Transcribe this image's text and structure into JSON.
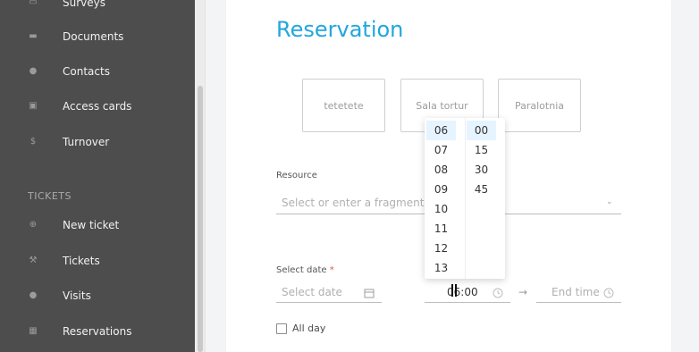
{
  "sidebar": {
    "items_top": [
      {
        "label": "Surveys",
        "icon": "clipboard-icon"
      },
      {
        "label": "Documents",
        "icon": "folder-icon"
      },
      {
        "label": "Contacts",
        "icon": "contacts-icon"
      },
      {
        "label": "Access cards",
        "icon": "card-icon"
      },
      {
        "label": "Turnover",
        "icon": "dollar-icon"
      }
    ],
    "section_title": "TICKETS",
    "items_tickets": [
      {
        "label": "New ticket",
        "icon": "plus-circle-icon"
      },
      {
        "label": "Tickets",
        "icon": "wrench-icon"
      },
      {
        "label": "Visits",
        "icon": "person-icon"
      },
      {
        "label": "Reservations",
        "icon": "calendar-icon"
      }
    ]
  },
  "main": {
    "title": "Reservation",
    "resource_options": [
      "tetetete",
      "Sala tortur",
      "Paralotnia"
    ],
    "resource_label": "Resource",
    "resource_placeholder": "Select or enter a fragment",
    "date_label": "Select date",
    "date_required_mark": "*",
    "date_placeholder": "Select date",
    "start_time_value": "06:00",
    "end_time_placeholder": "End time",
    "arrow": "→",
    "all_day_label": "All day"
  },
  "time_picker": {
    "hours": [
      "06",
      "07",
      "08",
      "09",
      "10",
      "11",
      "12",
      "13"
    ],
    "minutes": [
      "00",
      "15",
      "30",
      "45"
    ],
    "selected_hour": "06",
    "selected_minute": "00"
  },
  "colors": {
    "accent": "#21a6de",
    "sidebar_bg": "#4d4d4d",
    "required": "#e25353"
  }
}
